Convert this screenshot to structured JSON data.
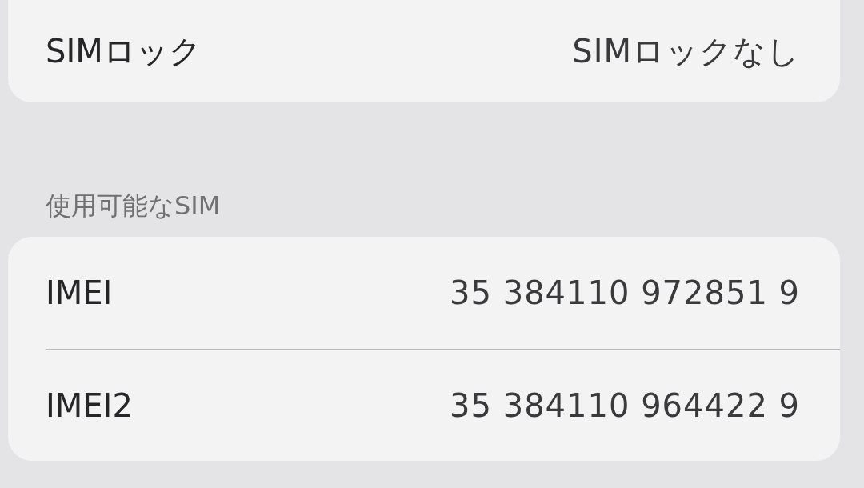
{
  "sections": [
    {
      "rows": [
        {
          "label": "SIMロック",
          "value": "SIMロックなし"
        }
      ]
    },
    {
      "header": "使用可能なSIM",
      "rows": [
        {
          "label": "IMEI",
          "value": "35 384110 972851 9"
        },
        {
          "label": "IMEI2",
          "value": "35 384110 964422 9"
        }
      ]
    }
  ]
}
